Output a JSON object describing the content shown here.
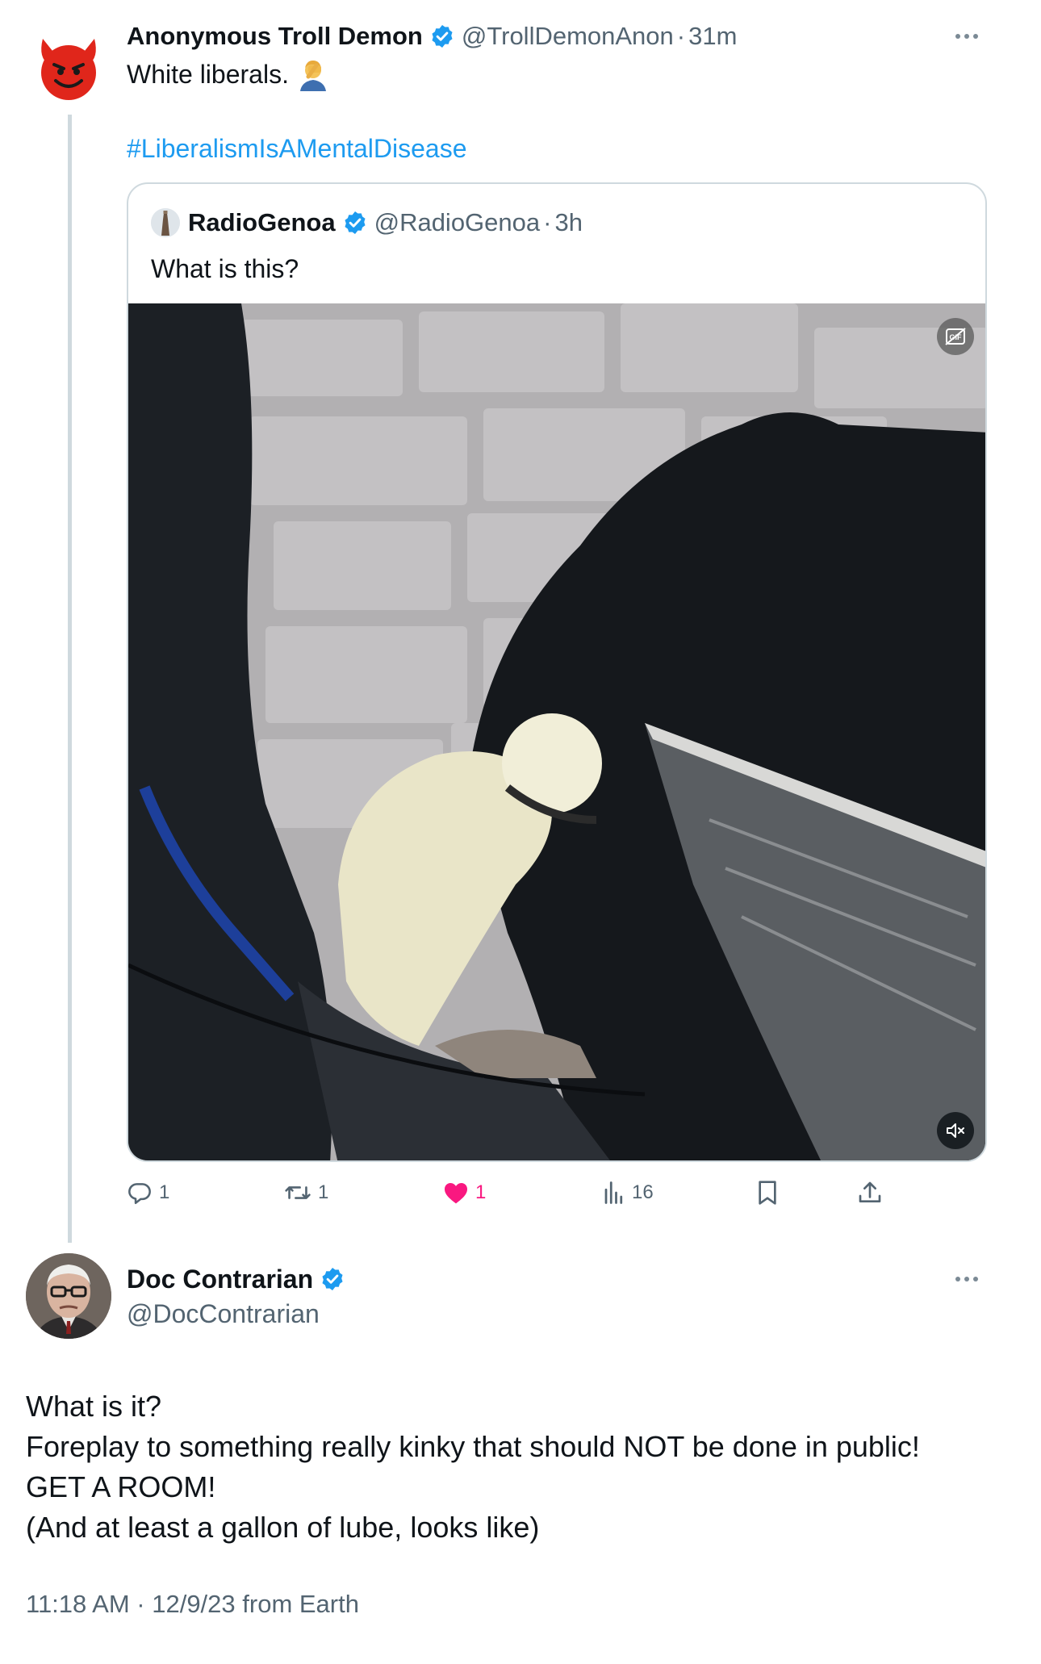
{
  "main_tweet": {
    "author_name": "Anonymous Troll Demon",
    "handle": "@TrollDemonAnon",
    "separator": "·",
    "time": "31m",
    "text": "White liberals.",
    "hashtag": "#LiberalismIsAMentalDisease",
    "avatar_icon": "smiling-devil-emoji",
    "text_emoji": "man-facepalming-emoji"
  },
  "quoted_tweet": {
    "author_name": "RadioGenoa",
    "handle": "@RadioGenoa",
    "separator": "·",
    "time": "3h",
    "text": "What is this?",
    "media_type": "video",
    "media_badges": [
      "gif-auto-play-icon",
      "muted-speaker-icon"
    ]
  },
  "actions": {
    "replies": "1",
    "reposts": "1",
    "likes": "1",
    "views": "16",
    "like_color": "#f91880",
    "icons": [
      "reply-icon",
      "repost-icon",
      "like-icon",
      "views-icon",
      "bookmark-icon",
      "share-icon"
    ]
  },
  "reply_tweet": {
    "author_name": "Doc Contrarian",
    "handle": "@DocContrarian",
    "lines": [
      "What is it?",
      "Foreplay to something really kinky that should NOT be done in public!",
      "GET A ROOM!",
      "(And at least a gallon of lube, looks like)"
    ],
    "timestamp": "11:18 AM · 12/9/23 from Earth"
  },
  "colors": {
    "verified_blue": "#1d9bf0",
    "link_blue": "#1d9bf0",
    "secondary_text": "#536471",
    "border": "#cfd9de"
  }
}
